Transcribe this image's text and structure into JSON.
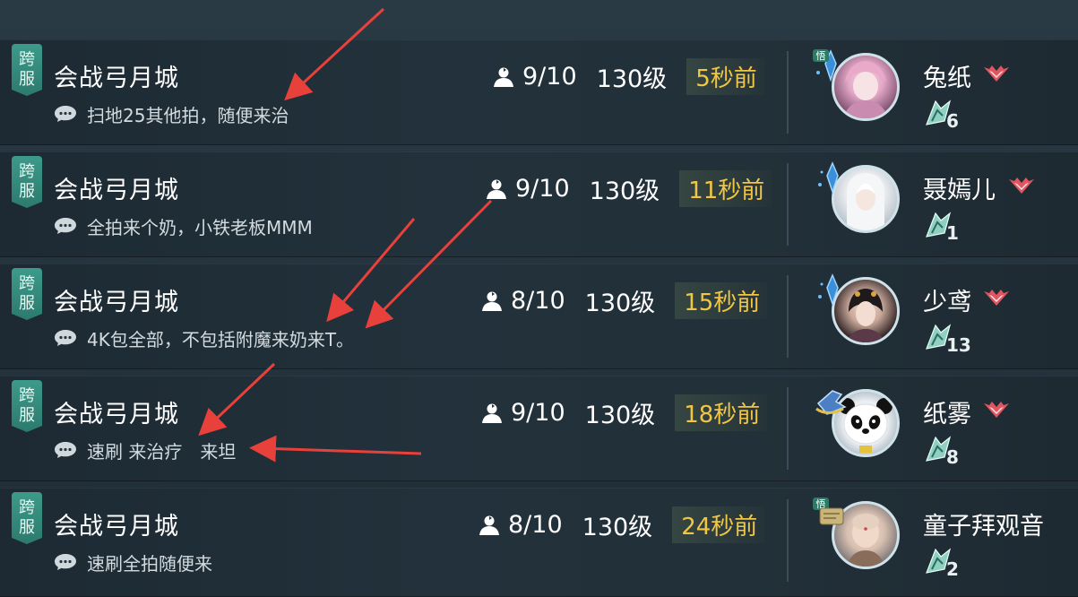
{
  "rows": [
    {
      "badge_top": "跨",
      "badge_bottom": "服",
      "title": "会战弓月城",
      "message": "扫地25其他拍，随便来治",
      "count": "9/10",
      "level": "130级",
      "time": "5秒前",
      "name": "兔纸",
      "avatar_tag": "悟",
      "school_num": "6",
      "has_rank": true
    },
    {
      "badge_top": "跨",
      "badge_bottom": "服",
      "title": "会战弓月城",
      "message": "全拍来个奶，小铁老板MMM",
      "count": "9/10",
      "level": "130级",
      "time": "11秒前",
      "name": "聂嫣儿",
      "avatar_tag": "",
      "school_num": "1",
      "has_rank": true
    },
    {
      "badge_top": "跨",
      "badge_bottom": "服",
      "title": "会战弓月城",
      "message": "4K包全部，不包括附魔来奶来T。",
      "count": "8/10",
      "level": "130级",
      "time": "15秒前",
      "name": "少鸢",
      "avatar_tag": "",
      "school_num": "13",
      "has_rank": true
    },
    {
      "badge_top": "跨",
      "badge_bottom": "服",
      "title": "会战弓月城",
      "message": "速刷 来治疗　来坦",
      "count": "9/10",
      "level": "130级",
      "time": "18秒前",
      "name": "纸雾",
      "avatar_tag": "",
      "school_num": "8",
      "has_rank": true
    },
    {
      "badge_top": "跨",
      "badge_bottom": "服",
      "title": "会战弓月城",
      "message": "速刷全拍随便来",
      "count": "8/10",
      "level": "130级",
      "time": "24秒前",
      "name": "童子拜观音",
      "avatar_tag": "悟",
      "school_num": "2",
      "has_rank": false
    }
  ],
  "colors": {
    "accent_time": "#f0c644",
    "badge": "#3d9a8a",
    "arrow": "#e8403a",
    "rank": "#e05560"
  },
  "icons": {
    "message": "chat-bubble-icon",
    "member": "person-icon",
    "rank": "rank-wings-icon",
    "school": "school-emblem-icon"
  }
}
